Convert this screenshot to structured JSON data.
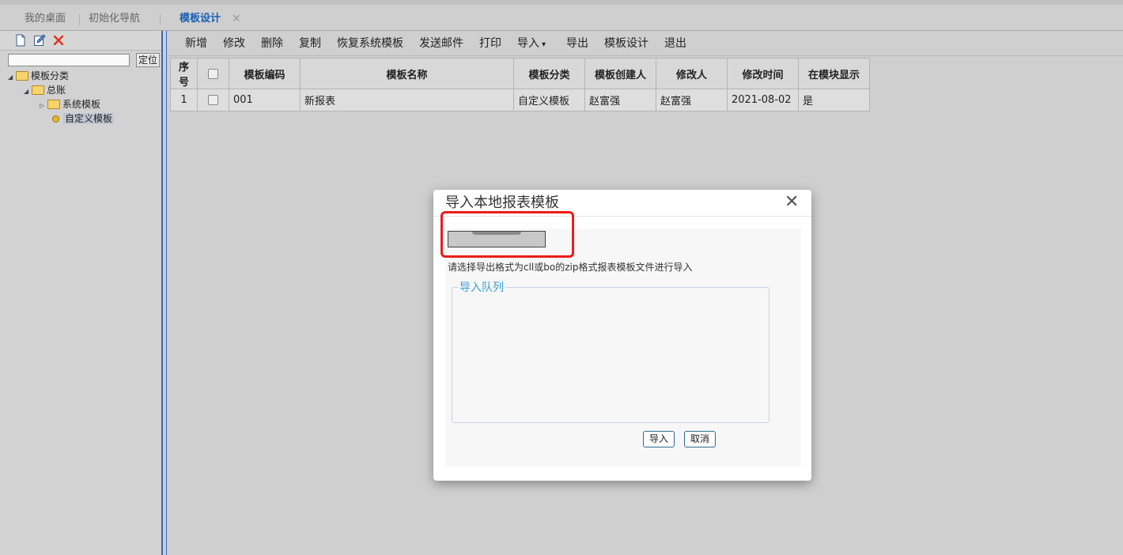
{
  "tabs": [
    {
      "label": "我的桌面"
    },
    {
      "label": "初始化导航"
    },
    {
      "label": "模板设计",
      "active": true,
      "closable": true
    }
  ],
  "tab_close_glyph": "✕",
  "left_panel": {
    "toolbar_icons": [
      "new-file-icon",
      "edit-icon",
      "delete-icon"
    ],
    "search_value": "",
    "locate_label": "定位",
    "tree": [
      {
        "label": "模板分类",
        "level": 0,
        "expanded": true
      },
      {
        "label": "总账",
        "level": 1,
        "expanded": true
      },
      {
        "label": "系统模板",
        "level": 2,
        "expanded": false
      },
      {
        "label": "自定义模板",
        "level": 3,
        "selected": true
      }
    ]
  },
  "toolbar": {
    "add": "新增",
    "modify": "修改",
    "delete": "删除",
    "copy": "复制",
    "restore": "恢复系统模板",
    "send_mail": "发送邮件",
    "print": "打印",
    "import": "导入",
    "export": "导出",
    "template_design": "模板设计",
    "exit": "退出"
  },
  "grid": {
    "headers": [
      "序号",
      "",
      "模板编码",
      "模板名称",
      "模板分类",
      "模板创建人",
      "修改人",
      "修改时间",
      "在模块显示"
    ],
    "rows": [
      [
        "1",
        "",
        "001",
        "新报表",
        "自定义模板",
        "赵富强",
        "赵富强",
        "2021-08-02",
        "是"
      ]
    ]
  },
  "dialog": {
    "title": "导入本地报表模板",
    "close_glyph": "✕",
    "hint": "请选择导出格式为cll或bo的zip格式报表模板文件进行导入",
    "queue_legend": "导入队列",
    "import_button": "导入",
    "cancel_button": "取消"
  },
  "colors": {
    "accent": "#3b6fd1",
    "highlight": "#f01a1a",
    "legend": "#3aa0d8"
  }
}
